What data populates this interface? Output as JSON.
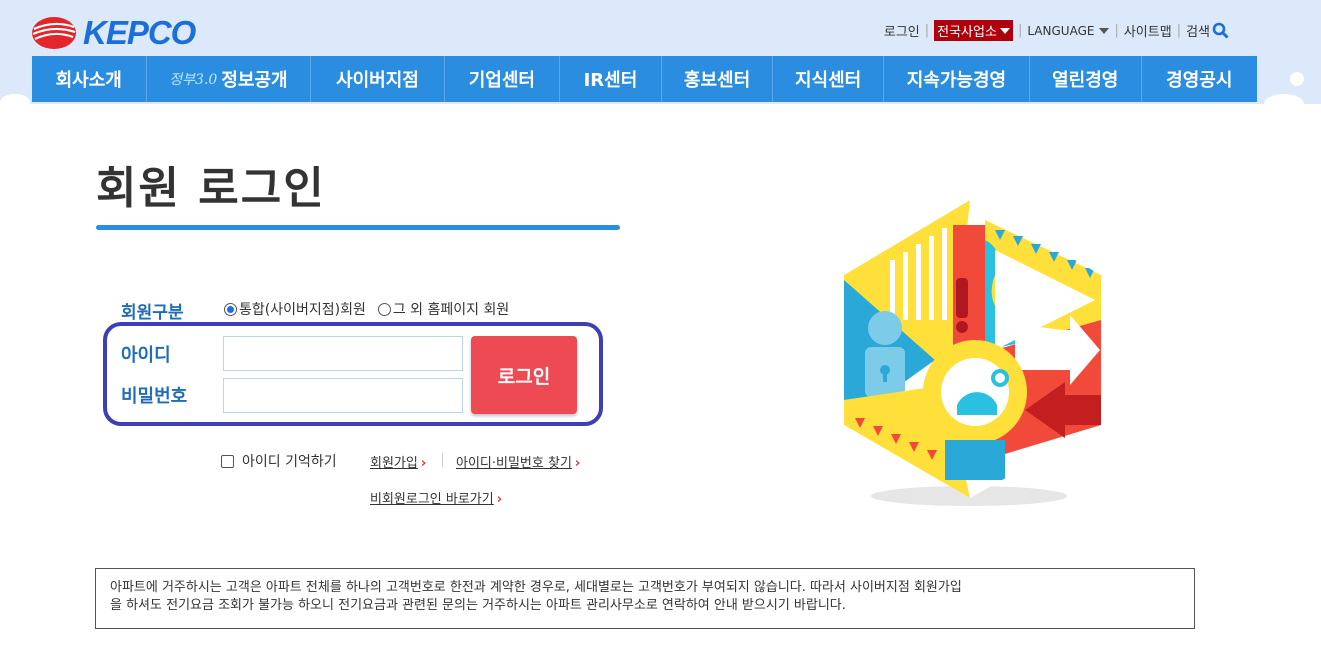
{
  "logo": {
    "text": "KEPCO"
  },
  "utility": {
    "login": "로그인",
    "region": "전국사업소",
    "language": "LANGUAGE",
    "sitemap": "사이트맵",
    "search": "검색"
  },
  "gnb": {
    "items": [
      {
        "label": "회사소개"
      },
      {
        "badge": "정부3.0",
        "label": "정보공개"
      },
      {
        "label": "사이버지점"
      },
      {
        "label": "기업센터"
      },
      {
        "label": "IR센터"
      },
      {
        "label": "홍보센터"
      },
      {
        "label": "지식센터"
      },
      {
        "label": "지속가능경영"
      },
      {
        "label": "열린경영"
      },
      {
        "label": "경영공시"
      }
    ]
  },
  "page": {
    "title": "회원 로그인"
  },
  "form": {
    "member_type_label": "회원구분",
    "options": [
      {
        "label": "통합(사이버지점)회원",
        "selected": true
      },
      {
        "label": "그 외 홈페이지 회원",
        "selected": false
      }
    ],
    "id_label": "아이디",
    "id_value": "",
    "password_label": "비밀번호",
    "password_value": "",
    "login_button": "로그인",
    "remember_label": "아이디 기억하기",
    "remember_checked": false,
    "signup_link": "회원가입",
    "find_link": "아이디·비밀번호 찾기",
    "guest_link": "비회원로그인 바로가기"
  },
  "notice": {
    "line1": "아파트에 거주하시는 고객은 아파트 전체를 하나의 고객번호로 한전과 계약한 경우로, 세대별로는 고객번호가 부여되지 않습니다. 따라서 사이버지점 회원가입",
    "line2": "을 하셔도 전기요금 조회가 불가능 하오니 전기요금과 관련된 문의는 거주하시는 아파트 관리사무소로 연락하여 안내 받으시기 바랍니다."
  },
  "colors": {
    "brand_blue": "#2b8de0",
    "title_blue": "#1f6db5",
    "login_red": "#ee4a54",
    "region_red": "#b0000b",
    "highlight": "#3d3fb6"
  }
}
